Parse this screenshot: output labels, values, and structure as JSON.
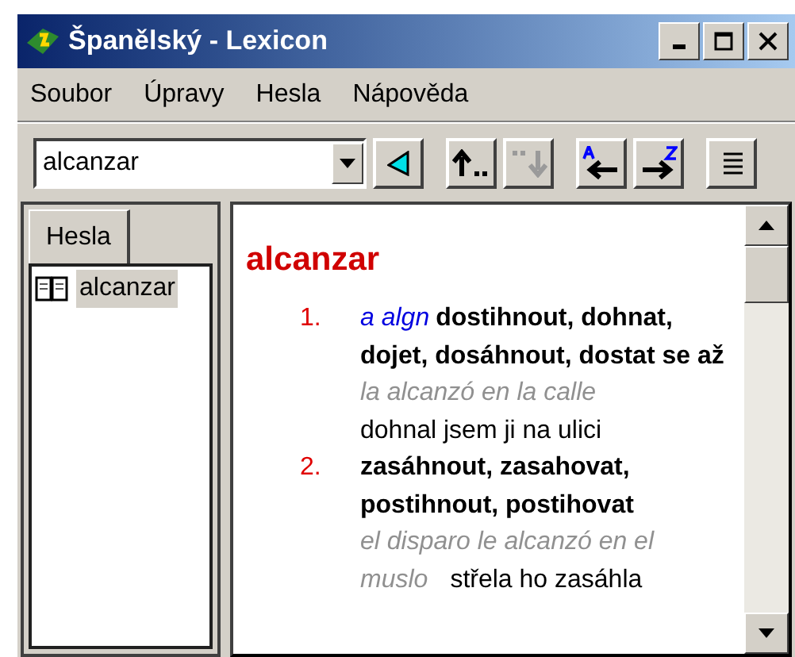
{
  "window": {
    "title": "Španělský - Lexicon"
  },
  "menu": [
    {
      "label": "Soubor"
    },
    {
      "label": "Úpravy"
    },
    {
      "label": "Hesla"
    },
    {
      "label": "Nápověda"
    }
  ],
  "toolbar": {
    "search": {
      "value": "alcanzar"
    },
    "buttons": [
      {
        "kind": "go",
        "disabled": false
      },
      {
        "kind": "back",
        "disabled": false
      },
      {
        "kind": "forward",
        "disabled": true
      },
      {
        "kind": "prev",
        "disabled": false
      },
      {
        "kind": "next",
        "disabled": false
      },
      {
        "kind": "view",
        "disabled": false
      }
    ]
  },
  "sidebar": {
    "tabs": [
      {
        "label": "Hesla",
        "selected": true
      }
    ],
    "items": [
      {
        "label": "alcanzar",
        "selected": true
      }
    ]
  },
  "entry": {
    "headword": "alcanzar",
    "senses": [
      {
        "number": "1.",
        "grammar": "a algn",
        "translation": "dostihnout, dohnat, dojet, dosáhnout, dostat se až",
        "example": "la alcanzó en la calle",
        "example_translation": "dohnal jsem ji na ulici"
      },
      {
        "number": "2.",
        "translation": "zasáhnout, zasahovat, postihnout, postihovat",
        "example": "el disparo le alcanzó en el muslo",
        "example_translation": "střela ho zasáhla"
      }
    ]
  }
}
